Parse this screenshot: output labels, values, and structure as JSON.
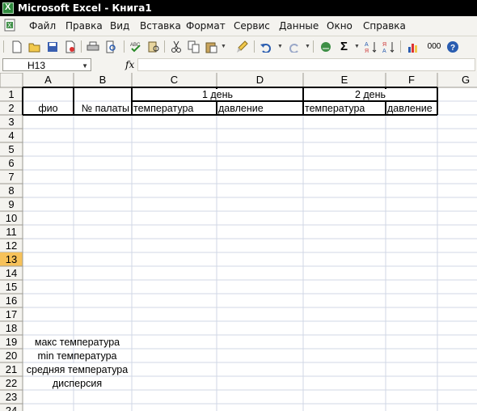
{
  "window": {
    "title": "Microsoft Excel - Книга1"
  },
  "menu": [
    "Файл",
    "Правка",
    "Вид",
    "Вставка",
    "Формат",
    "Сервис",
    "Данные",
    "Окно",
    "Справка"
  ],
  "toolbar": {
    "icons": [
      "new-icon",
      "open-icon",
      "save-icon",
      "permission-icon",
      "print-icon",
      "print-preview-icon",
      "spelling-icon",
      "research-icon",
      "cut-icon",
      "copy-icon",
      "paste-icon",
      "format-painter-icon",
      "undo-icon",
      "redo-icon",
      "hyperlink-icon",
      "autosum-icon",
      "sort-ascending-icon",
      "sort-descending-icon",
      "chart-wizard-icon",
      "thousands-icon",
      "help-icon"
    ],
    "autosum_glyph": "Σ",
    "thousands_glyph": "000",
    "fx_glyph": "fx"
  },
  "name_box": {
    "value": "H13"
  },
  "formula": {
    "value": ""
  },
  "sheet": {
    "columns": [
      "A",
      "B",
      "C",
      "D",
      "E",
      "F",
      "G"
    ],
    "rows": [
      "1",
      "2",
      "3",
      "4",
      "5",
      "6",
      "7",
      "8",
      "9",
      "10",
      "11",
      "12",
      "13",
      "14",
      "15",
      "16",
      "17",
      "18",
      "19",
      "20",
      "21",
      "22",
      "23",
      "24"
    ],
    "active_row": "13",
    "cells": {
      "C1": "1 день",
      "E1": "2 день",
      "A2": "фио",
      "B2": "№ палаты",
      "C2": "температура",
      "D2": "давление",
      "E2": "температура",
      "F2": "давление",
      "A19": "макс температура",
      "A20": "min температура",
      "A21": "средняя температура",
      "A22": "дисперсия"
    }
  },
  "colors": {
    "title_bg": "#000000",
    "header_bg": "#f4f3ef",
    "active_header_bg": "#f7c25a",
    "grid": "#d0d7e5"
  }
}
